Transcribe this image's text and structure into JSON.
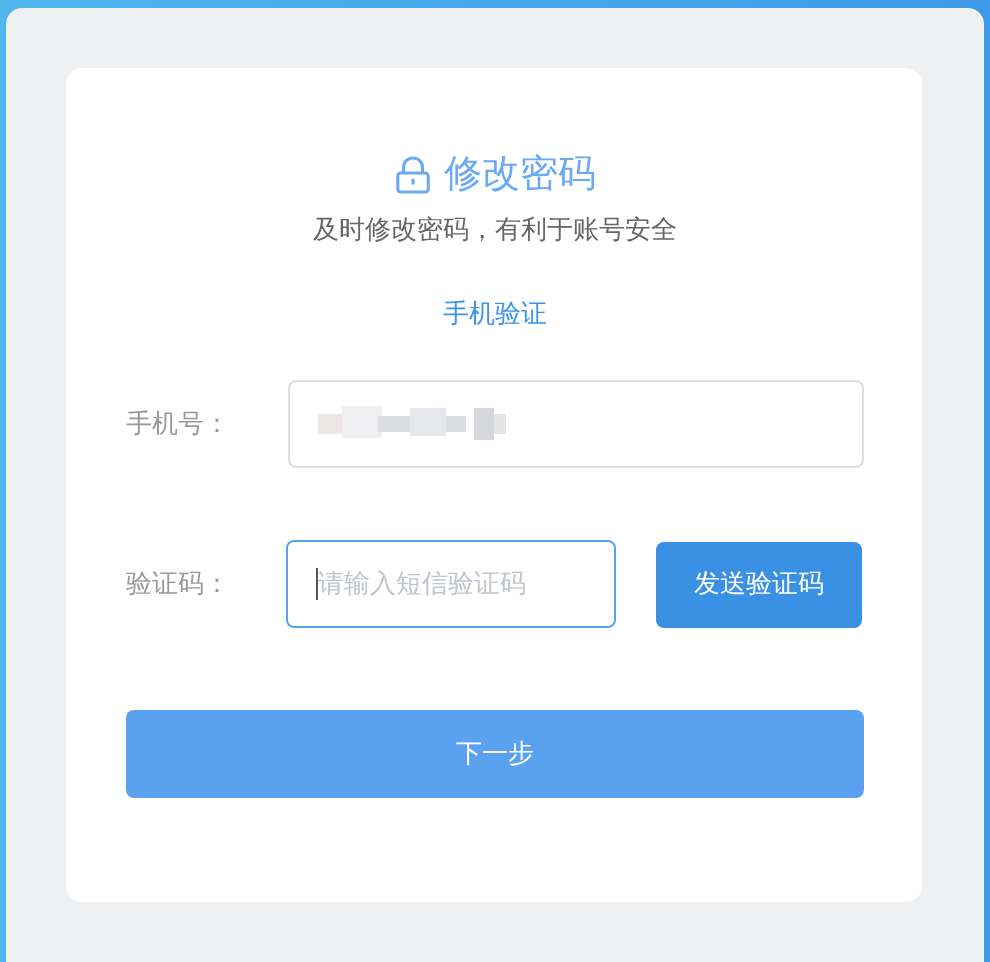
{
  "title": "修改密码",
  "subtitle": "及时修改密码，有利于账号安全",
  "tabs": [
    {
      "label": "手机验证",
      "selected": true
    }
  ],
  "fields": [
    {
      "label": "手机号：",
      "kind": "phone",
      "focused": false
    },
    {
      "label": "验证码：",
      "kind": "code",
      "placeholder": "请输入短信验证码",
      "focused": true,
      "button": "发送验证码"
    }
  ],
  "submit": "下一步"
}
